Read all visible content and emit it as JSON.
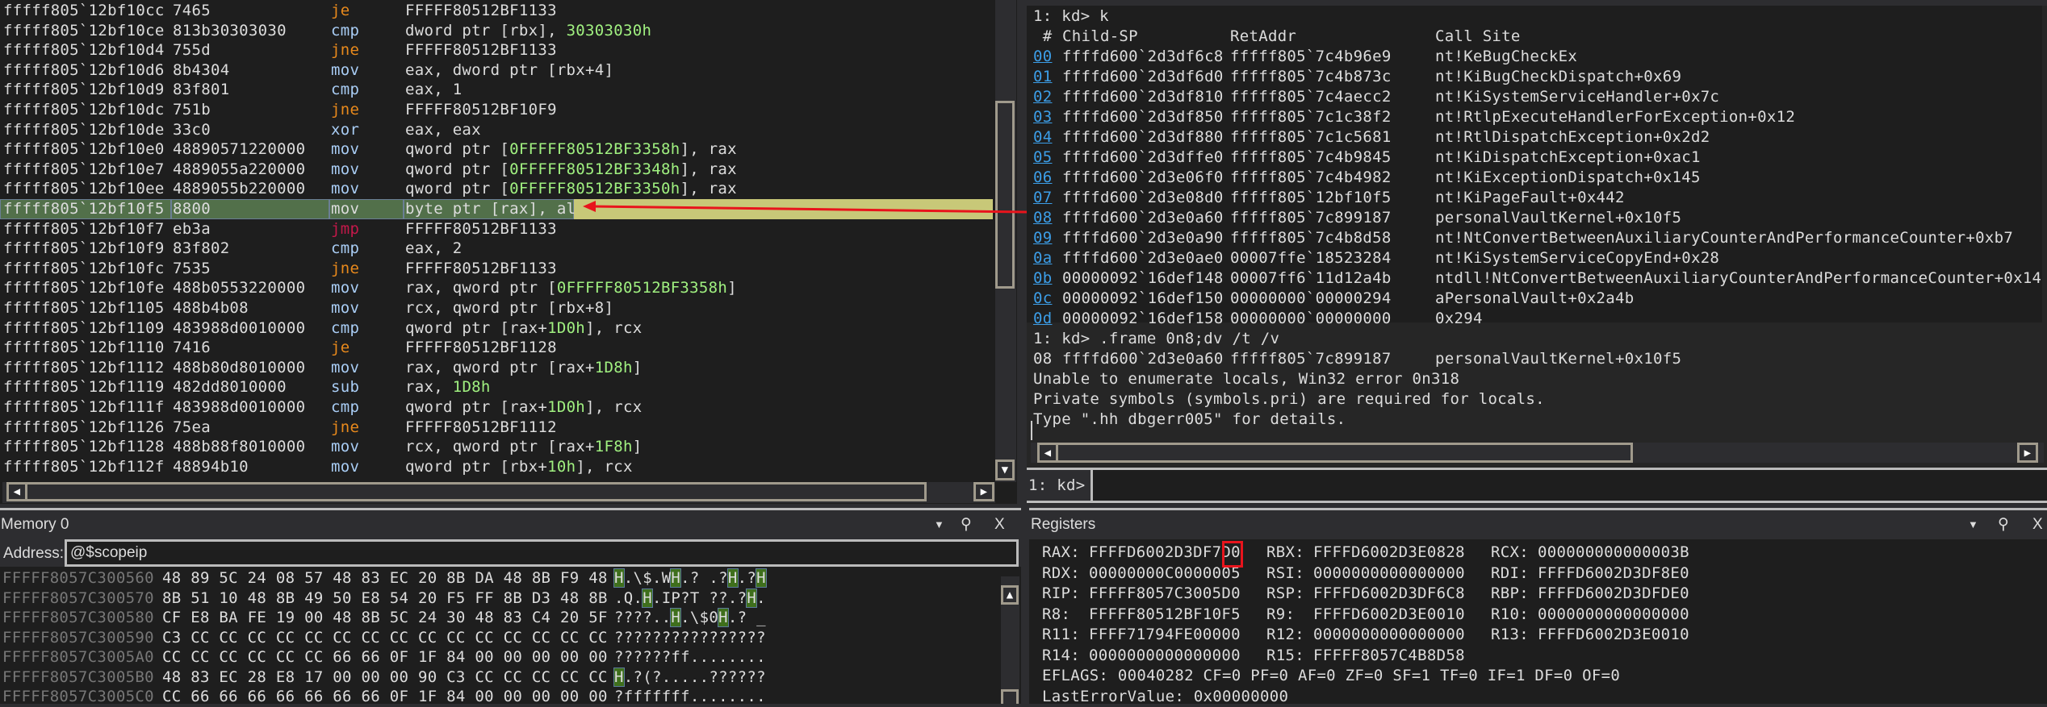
{
  "disassembly": {
    "rows": [
      {
        "addr": "fffff805`12bf10cc",
        "bytes": "7465",
        "mn": "je",
        "op": [
          [
            "FFFFF80512BF1133",
            ""
          ]
        ]
      },
      {
        "addr": "fffff805`12bf10ce",
        "bytes": "813b30303030",
        "mn": "cmp",
        "op": [
          [
            "dword ptr [rbx], ",
            ""
          ],
          [
            "30303030h",
            "num"
          ]
        ]
      },
      {
        "addr": "fffff805`12bf10d4",
        "bytes": "755d",
        "mn": "jne",
        "op": [
          [
            "FFFFF80512BF1133",
            ""
          ]
        ]
      },
      {
        "addr": "fffff805`12bf10d6",
        "bytes": "8b4304",
        "mn": "mov",
        "op": [
          [
            "eax, dword ptr [rbx+4]",
            ""
          ]
        ]
      },
      {
        "addr": "fffff805`12bf10d9",
        "bytes": "83f801",
        "mn": "cmp",
        "op": [
          [
            "eax, 1",
            ""
          ]
        ]
      },
      {
        "addr": "fffff805`12bf10dc",
        "bytes": "751b",
        "mn": "jne",
        "op": [
          [
            "FFFFF80512BF10F9",
            ""
          ]
        ]
      },
      {
        "addr": "fffff805`12bf10de",
        "bytes": "33c0",
        "mn": "xor",
        "op": [
          [
            "eax, eax",
            ""
          ]
        ]
      },
      {
        "addr": "fffff805`12bf10e0",
        "bytes": "48890571220000",
        "mn": "mov",
        "op": [
          [
            "qword ptr [",
            ""
          ],
          [
            "0FFFFF80512BF3358h",
            "num"
          ],
          [
            "], rax",
            ""
          ]
        ]
      },
      {
        "addr": "fffff805`12bf10e7",
        "bytes": "4889055a220000",
        "mn": "mov",
        "op": [
          [
            "qword ptr [",
            ""
          ],
          [
            "0FFFFF80512BF3348h",
            "num"
          ],
          [
            "], rax",
            ""
          ]
        ]
      },
      {
        "addr": "fffff805`12bf10ee",
        "bytes": "4889055b220000",
        "mn": "mov",
        "op": [
          [
            "qword ptr [",
            ""
          ],
          [
            "0FFFFF80512BF3350h",
            "num"
          ],
          [
            "], rax",
            ""
          ]
        ]
      },
      {
        "addr": "fffff805`12bf10f5",
        "bytes": "8800",
        "mn": "mov",
        "op": [
          [
            "byte ptr [rax], al",
            ""
          ]
        ],
        "current": true
      },
      {
        "addr": "fffff805`12bf10f7",
        "bytes": "eb3a",
        "mn": "jmp",
        "op": [
          [
            "FFFFF80512BF1133",
            ""
          ]
        ]
      },
      {
        "addr": "fffff805`12bf10f9",
        "bytes": "83f802",
        "mn": "cmp",
        "op": [
          [
            "eax, 2",
            ""
          ]
        ]
      },
      {
        "addr": "fffff805`12bf10fc",
        "bytes": "7535",
        "mn": "jne",
        "op": [
          [
            "FFFFF80512BF1133",
            ""
          ]
        ]
      },
      {
        "addr": "fffff805`12bf10fe",
        "bytes": "488b0553220000",
        "mn": "mov",
        "op": [
          [
            "rax, qword ptr [",
            ""
          ],
          [
            "0FFFFF80512BF3358h",
            "num"
          ],
          [
            "]",
            ""
          ]
        ]
      },
      {
        "addr": "fffff805`12bf1105",
        "bytes": "488b4b08",
        "mn": "mov",
        "op": [
          [
            "rcx, qword ptr [rbx+8]",
            ""
          ]
        ]
      },
      {
        "addr": "fffff805`12bf1109",
        "bytes": "483988d0010000",
        "mn": "cmp",
        "op": [
          [
            "qword ptr [rax+",
            ""
          ],
          [
            "1D0h",
            "num"
          ],
          [
            "], rcx",
            ""
          ]
        ]
      },
      {
        "addr": "fffff805`12bf1110",
        "bytes": "7416",
        "mn": "je",
        "op": [
          [
            "FFFFF80512BF1128",
            ""
          ]
        ]
      },
      {
        "addr": "fffff805`12bf1112",
        "bytes": "488b80d8010000",
        "mn": "mov",
        "op": [
          [
            "rax, qword ptr [rax+",
            ""
          ],
          [
            "1D8h",
            "num"
          ],
          [
            "]",
            ""
          ]
        ]
      },
      {
        "addr": "fffff805`12bf1119",
        "bytes": "482dd8010000",
        "mn": "sub",
        "op": [
          [
            "rax, ",
            ""
          ],
          [
            "1D8h",
            "num"
          ]
        ]
      },
      {
        "addr": "fffff805`12bf111f",
        "bytes": "483988d0010000",
        "mn": "cmp",
        "op": [
          [
            "qword ptr [rax+",
            ""
          ],
          [
            "1D0h",
            "num"
          ],
          [
            "], rcx",
            ""
          ]
        ]
      },
      {
        "addr": "fffff805`12bf1126",
        "bytes": "75ea",
        "mn": "jne",
        "op": [
          [
            "FFFFF80512BF1112",
            ""
          ]
        ]
      },
      {
        "addr": "fffff805`12bf1128",
        "bytes": "488b88f8010000",
        "mn": "mov",
        "op": [
          [
            "rcx, qword ptr [rax+",
            ""
          ],
          [
            "1F8h",
            "num"
          ],
          [
            "]",
            ""
          ]
        ]
      },
      {
        "addr": "fffff805`12bf112f",
        "bytes": "48894b10",
        "mn": "mov",
        "op": [
          [
            "qword ptr [rbx+",
            ""
          ],
          [
            "10h",
            "num"
          ],
          [
            "], rcx",
            ""
          ]
        ]
      }
    ]
  },
  "command": {
    "cmd1": "1: kd> k",
    "stack_header": {
      "num": " #",
      "sp": "Child-SP",
      "ret": "RetAddr",
      "site": "Call Site"
    },
    "stack": [
      {
        "n": "00",
        "sp": "ffffd600`2d3df6c8",
        "ret": "fffff805`7c4b96e9",
        "site": "nt!KeBugCheckEx"
      },
      {
        "n": "01",
        "sp": "ffffd600`2d3df6d0",
        "ret": "fffff805`7c4b873c",
        "site": "nt!KiBugCheckDispatch+0x69"
      },
      {
        "n": "02",
        "sp": "ffffd600`2d3df810",
        "ret": "fffff805`7c4aecc2",
        "site": "nt!KiSystemServiceHandler+0x7c"
      },
      {
        "n": "03",
        "sp": "ffffd600`2d3df850",
        "ret": "fffff805`7c1c38f2",
        "site": "nt!RtlpExecuteHandlerForException+0x12"
      },
      {
        "n": "04",
        "sp": "ffffd600`2d3df880",
        "ret": "fffff805`7c1c5681",
        "site": "nt!RtlDispatchException+0x2d2"
      },
      {
        "n": "05",
        "sp": "ffffd600`2d3dffe0",
        "ret": "fffff805`7c4b9845",
        "site": "nt!KiDispatchException+0xac1"
      },
      {
        "n": "06",
        "sp": "ffffd600`2d3e06f0",
        "ret": "fffff805`7c4b4982",
        "site": "nt!KiExceptionDispatch+0x145"
      },
      {
        "n": "07",
        "sp": "ffffd600`2d3e08d0",
        "ret": "fffff805`12bf10f5",
        "site": "nt!KiPageFault+0x442"
      },
      {
        "n": "08",
        "sp": "ffffd600`2d3e0a60",
        "ret": "fffff805`7c899187",
        "site": "personalVaultKernel+0x10f5"
      },
      {
        "n": "09",
        "sp": "ffffd600`2d3e0a90",
        "ret": "fffff805`7c4b8d58",
        "site": "nt!NtConvertBetweenAuxiliaryCounterAndPerformanceCounter+0xb7"
      },
      {
        "n": "0a",
        "sp": "ffffd600`2d3e0ae0",
        "ret": "00007ffe`18523284",
        "site": "nt!KiSystemServiceCopyEnd+0x28"
      },
      {
        "n": "0b",
        "sp": "00000092`16def148",
        "ret": "00007ff6`11d12a4b",
        "site": "ntdll!NtConvertBetweenAuxiliaryCounterAndPerformanceCounter+0x14"
      },
      {
        "n": "0c",
        "sp": "00000092`16def150",
        "ret": "00000000`00000294",
        "site": "aPersonalVault+0x2a4b"
      },
      {
        "n": "0d",
        "sp": "00000092`16def158",
        "ret": "00000000`00000000",
        "site": "0x294"
      }
    ],
    "cmd2": "1: kd> .frame 0n8;dv /t /v",
    "frame_line": {
      "n": "08",
      "sp": "ffffd600`2d3e0a60",
      "ret": "fffff805`7c899187",
      "site": "personalVaultKernel+0x10f5"
    },
    "messages": [
      "Unable to enumerate locals, Win32 error 0n318",
      "Private symbols (symbols.pri) are required for locals.",
      "Type \".hh dbgerr005\" for details."
    ],
    "prompt": "1: kd>",
    "input_value": ""
  },
  "memory": {
    "title": "Memory 0",
    "address_label": "Address:",
    "address_value": "@$scopeip",
    "rows": [
      {
        "addr": "FFFFF8057C300560",
        "bytes": "48 89 5C 24 08 57 48 83 EC 20 8B DA 48 8B F9 48",
        "ascii": "H.\\$.WH.? .?H.?H"
      },
      {
        "addr": "FFFFF8057C300570",
        "bytes": "8B 51 10 48 8B 49 50 E8 54 20 F5 FF 8B D3 48 8B",
        "ascii": ".Q.H.IP?T ??.?H."
      },
      {
        "addr": "FFFFF8057C300580",
        "bytes": "CF E8 BA FE 19 00 48 8B 5C 24 30 48 83 C4 20 5F",
        "ascii": "????..H.\\$0H.? _"
      },
      {
        "addr": "FFFFF8057C300590",
        "bytes": "C3 CC CC CC CC CC CC CC CC CC CC CC CC CC CC CC",
        "ascii": "????????????????"
      },
      {
        "addr": "FFFFF8057C3005A0",
        "bytes": "CC CC CC CC CC CC 66 66 0F 1F 84 00 00 00 00 00",
        "ascii": "??????ff........"
      },
      {
        "addr": "FFFFF8057C3005B0",
        "bytes": "48 83 EC 28 E8 17 00 00 00 90 C3 CC CC CC CC CC",
        "ascii": "H.?(?.....??????"
      },
      {
        "addr": "FFFFF8057C3005C0",
        "bytes": "CC 66 66 66 66 66 66 66 0F 1F 84 00 00 00 00 00",
        "ascii": "?fffffff........"
      }
    ]
  },
  "registers": {
    "title": "Registers",
    "rows": [
      [
        [
          "RAX:",
          "FFFFD6002D3DF7D0"
        ],
        [
          "RBX:",
          "FFFFD6002D3E0828"
        ],
        [
          "RCX:",
          "000000000000003B"
        ]
      ],
      [
        [
          "RDX:",
          "00000000C0000005"
        ],
        [
          "RSI:",
          "0000000000000000"
        ],
        [
          "RDI:",
          "FFFFD6002D3DF8E0"
        ]
      ],
      [
        [
          "RIP:",
          "FFFFF8057C3005D0"
        ],
        [
          "RSP:",
          "FFFFD6002D3DF6C8"
        ],
        [
          "RBP:",
          "FFFFD6002D3DFDE0"
        ]
      ],
      [
        [
          "R8:",
          "FFFFF80512BF10F5"
        ],
        [
          "R9:",
          "FFFFD6002D3E0010"
        ],
        [
          "R10:",
          "0000000000000000"
        ]
      ],
      [
        [
          "R11:",
          "FFFF71794FE00000"
        ],
        [
          "R12:",
          "0000000000000000"
        ],
        [
          "R13:",
          "FFFFD6002D3E0010"
        ]
      ],
      [
        [
          "R14:",
          "0000000000000000"
        ],
        [
          "R15:",
          "FFFFF8057C4B8D58"
        ]
      ]
    ],
    "eflags": "EFLAGS: 00040282 CF=0 PF=0 AF=0 ZF=0 SF=1 TF=0 IF=1 DF=0 OF=0",
    "last_error": "LastErrorValue: 0x00000000"
  },
  "pane_icons": {
    "dropdown": "▼",
    "pin": "pin-icon",
    "close": "X"
  },
  "colors": {
    "annotation": "#e8141c",
    "highlight_row": "#c8c878",
    "current_cell": "#52704a",
    "link": "#3c9ee8"
  }
}
